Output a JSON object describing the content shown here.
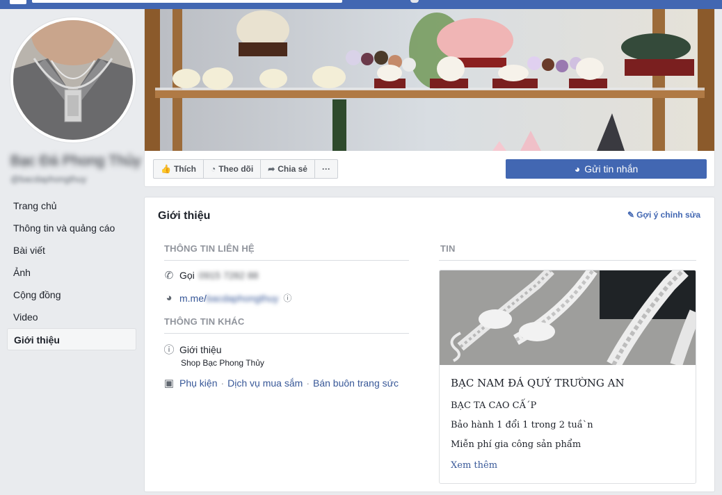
{
  "page": {
    "name": "Bạc Đá Phong Thủy",
    "username": "@bacdaphongthuy"
  },
  "left_nav": [
    {
      "label": "Trang chủ",
      "active": false
    },
    {
      "label": "Thông tin và quảng cáo",
      "active": false
    },
    {
      "label": "Bài viết",
      "active": false
    },
    {
      "label": "Ảnh",
      "active": false
    },
    {
      "label": "Cộng đồng",
      "active": false
    },
    {
      "label": "Video",
      "active": false
    },
    {
      "label": "Giới thiệu",
      "active": true
    }
  ],
  "actions": {
    "like": "Thích",
    "follow": "Theo dõi",
    "share": "Chia sẻ",
    "more": "···",
    "message": "Gửi tin nhắn"
  },
  "about": {
    "title": "Giới thiệu",
    "suggest_edit": "Gợi ý chỉnh sửa",
    "contact_header": "THÔNG TIN LIÊN HỆ",
    "call_label": "Gọi",
    "phone": "0915 7282 88",
    "messenger_prefix": "m.me/",
    "messenger_handle": "bacdaphongthuy",
    "other_header": "THÔNG TIN KHÁC",
    "intro_label": "Giới thiệu",
    "intro_text": "Shop Bạc Phong Thủy",
    "categories": [
      "Phụ kiện",
      "Dịch vụ mua sắm",
      "Bán buôn trang sức"
    ],
    "news_header": "TIN"
  },
  "news": {
    "headline": "BẠC NAM ĐÁ QUÝ TRƯỜNG AN",
    "line1": "BẠC TA CAO CẤ´P",
    "line2": "Bảo hành 1 đổi 1 trong 2 tuầ`n",
    "line3": "Miễn phí gia công sản phẩm",
    "see_more": "Xem thêm"
  },
  "colors": {
    "brand_blue": "#4267b2",
    "link_blue": "#385898",
    "background": "#e9ebee"
  }
}
